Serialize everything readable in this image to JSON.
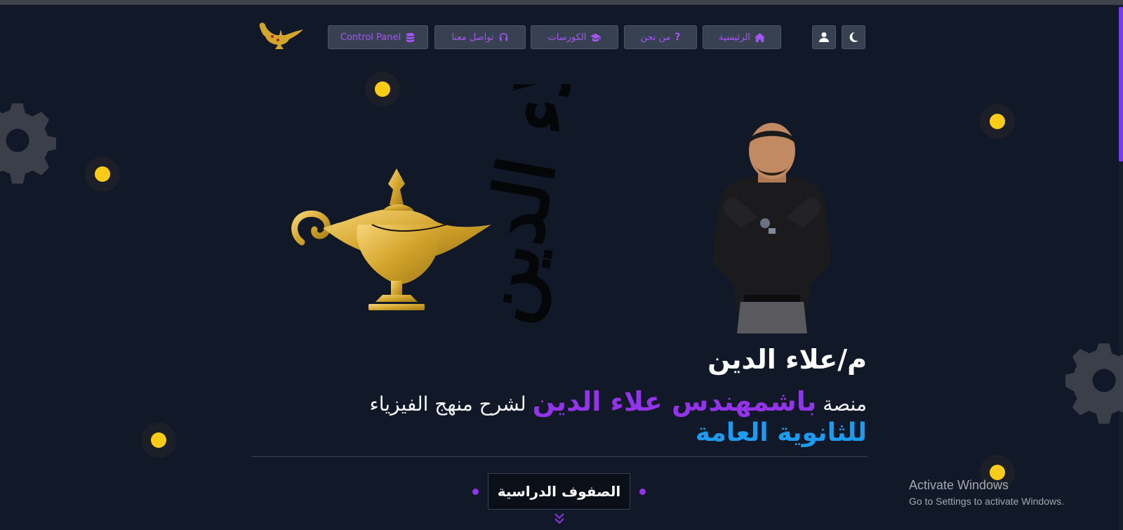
{
  "nav": {
    "items": [
      {
        "label": "الرئيسية",
        "icon": "home-icon"
      },
      {
        "label": "من نحن",
        "icon": "question-icon"
      },
      {
        "label": "الكورسات",
        "icon": "graduation-cap-icon"
      },
      {
        "label": "تواصل معنا",
        "icon": "headset-icon"
      },
      {
        "label": "Control Panel",
        "icon": "database-icon"
      }
    ],
    "user_icon": "user-icon",
    "theme_icon": "moon-icon",
    "logo_icon": "magic-lamp-icon"
  },
  "hero": {
    "logo_text": "علاء الدين",
    "title": "م/علاء الدين",
    "subtitle_prefix": "منصة",
    "subtitle_highlight": "باشمهندس علاء الدين",
    "subtitle_suffix": "لشرح منهج الفيزياء",
    "subtitle_line2": "للثانوية العامة"
  },
  "section": {
    "label": "الصفوف الدراسية",
    "scroll_icon": "double-chevron-down-icon"
  },
  "watermark": {
    "line1": "Activate Windows",
    "line2": "Go to Settings to activate Windows."
  },
  "colors": {
    "background": "#111827",
    "accent_purple": "#9333ea",
    "accent_blue": "#1d9bf0",
    "dot_yellow": "#facc15",
    "lamp_gold": "#d4a52c"
  }
}
